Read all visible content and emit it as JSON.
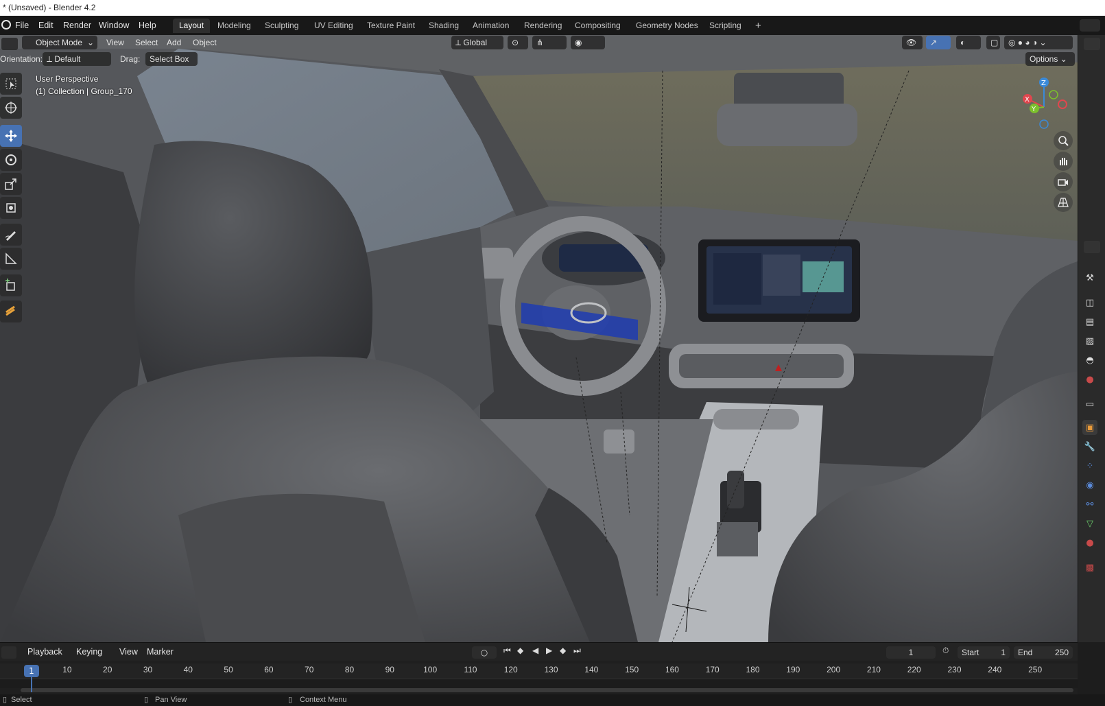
{
  "window": {
    "title": "* (Unsaved) - Blender 4.2"
  },
  "menubar": {
    "items": [
      "File",
      "Edit",
      "Render",
      "Window",
      "Help"
    ]
  },
  "workspaces": {
    "tabs": [
      "Layout",
      "Modeling",
      "Sculpting",
      "UV Editing",
      "Texture Paint",
      "Shading",
      "Animation",
      "Rendering",
      "Compositing",
      "Geometry Nodes",
      "Scripting"
    ],
    "active": "Layout",
    "add_label": "+"
  },
  "viewport_header": {
    "mode": "Object Mode",
    "menus": [
      "View",
      "Select",
      "Add",
      "Object"
    ],
    "transform_orientation": "Global",
    "orientation_label": "Orientation:",
    "orientation_value": "Default",
    "drag_label": "Drag:",
    "drag_value": "Select Box",
    "options_label": "Options"
  },
  "viewport_overlay": {
    "view_name": "User Perspective",
    "collection_info": "(1) Collection | Group_170"
  },
  "gizmo": {
    "x": "X",
    "y": "Y",
    "z": "Z"
  },
  "colors": {
    "active_tool": "#4772b3",
    "gizmo_x": "#e0464e",
    "gizmo_y": "#7cc12d",
    "gizmo_z": "#3a8ad9",
    "frame_marker": "#4772b3"
  },
  "timeline": {
    "menus": [
      "Playback",
      "Keying",
      "View",
      "Marker"
    ],
    "current_frame": "1",
    "start_label": "Start",
    "start_value": "1",
    "end_label": "End",
    "end_value": "250",
    "ruler": [
      "10",
      "20",
      "30",
      "40",
      "50",
      "60",
      "70",
      "80",
      "90",
      "100",
      "110",
      "120",
      "130",
      "140",
      "150",
      "160",
      "170",
      "180",
      "190",
      "200",
      "210",
      "220",
      "230",
      "240",
      "250"
    ],
    "marker_frame": "1"
  },
  "statusbar": {
    "select": "Select",
    "pan_view": "Pan View",
    "context_menu": "Context Menu"
  }
}
